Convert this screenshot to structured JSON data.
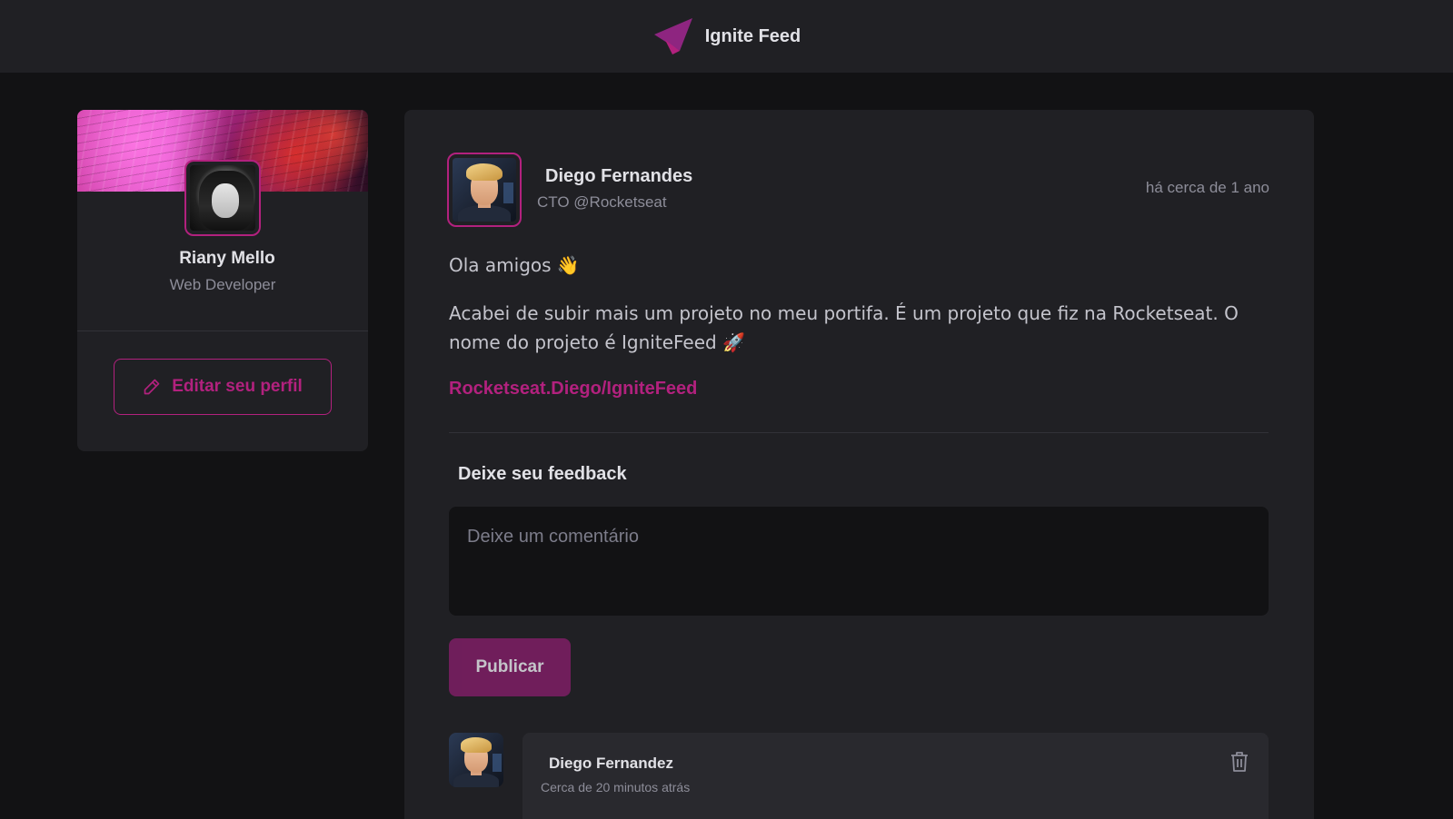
{
  "header": {
    "app_title": "Ignite Feed",
    "logo_icon": "paper-plane-logo-icon"
  },
  "sidebar": {
    "name": "Riany Mello",
    "role": "Web Developer",
    "edit_button_label": "Editar seu perfil",
    "edit_icon": "pencil-icon"
  },
  "post": {
    "author_name": "Diego Fernandes",
    "author_role": "CTO @Rocketseat",
    "time": "há cerca de 1 ano",
    "greeting": "Ola amigos 👋",
    "body": "Acabei de subir mais um projeto no meu portifa. É um projeto que fiz na Rocketseat. O nome do projeto é IgniteFeed 🚀",
    "link": "Rocketseat.Diego/IgniteFeed"
  },
  "feedback": {
    "title": "Deixe seu feedback",
    "placeholder": "Deixe um comentário",
    "publish_label": "Publicar"
  },
  "comments": [
    {
      "author": "Diego Fernandez",
      "time": "Cerca de 20 minutos atrás",
      "delete_icon": "trash-icon"
    }
  ],
  "colors": {
    "background": "#121214",
    "surface": "#202024",
    "accent": "#b2217e",
    "button": "#7e1e65",
    "text": "#e1e1e6",
    "muted": "#8d8d99"
  }
}
